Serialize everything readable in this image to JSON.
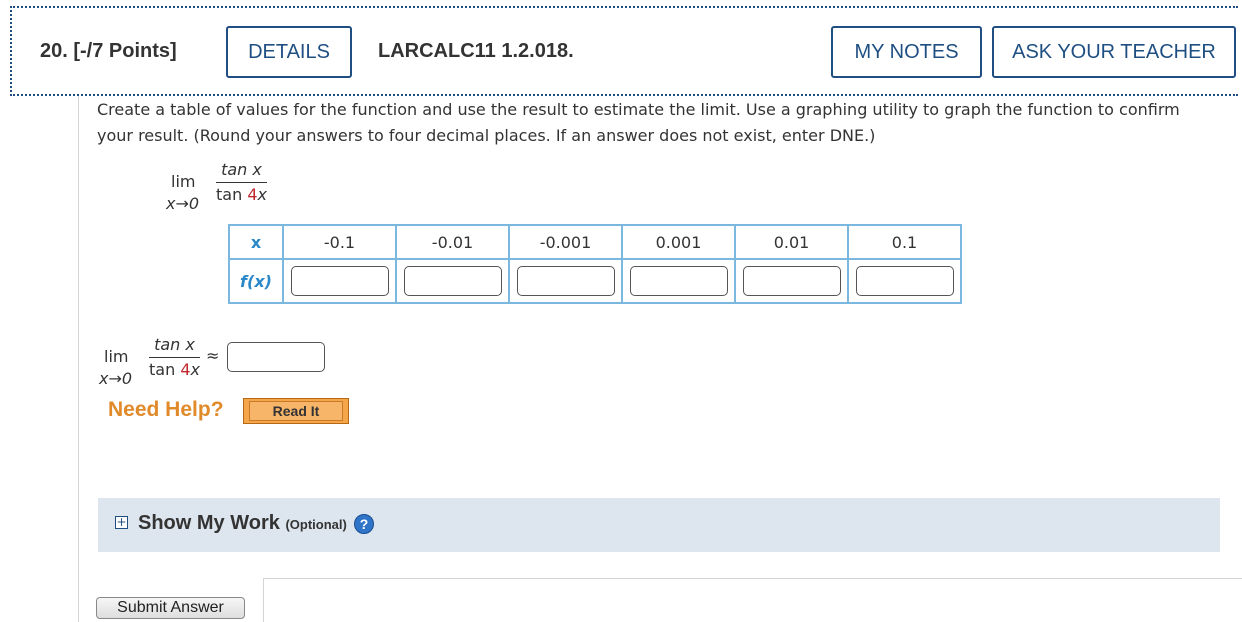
{
  "header": {
    "question_number": "20.  [-/7 Points]",
    "details_label": "DETAILS",
    "code": "LARCALC11 1.2.018.",
    "my_notes_label": "MY NOTES",
    "ask_teacher_label": "ASK YOUR TEACHER"
  },
  "instructions": "Create a table of values for the function and use the result to estimate the limit. Use a graphing utility to graph the function to confirm your result. (Round your answers to four decimal places. If an answer does not exist, enter DNE.)",
  "limit": {
    "lim": "lim",
    "approach": "x→0",
    "numerator": "tan x",
    "den_prefix": "tan ",
    "den_coef": "4",
    "den_var": "x"
  },
  "table": {
    "x_header": "x",
    "fx_header": "f(x)",
    "x_values": [
      "-0.1",
      "-0.01",
      "-0.001",
      "0.001",
      "0.01",
      "0.1"
    ]
  },
  "answer": {
    "approx_symbol": "≈"
  },
  "help": {
    "need_help": "Need Help?",
    "read_it": "Read It"
  },
  "show_work": {
    "plus_icon": "+",
    "label": "Show My Work",
    "optional": "(Optional)",
    "help_icon": "?"
  },
  "submit_label": "Submit Answer",
  "colors": {
    "accent": "#1f4f82",
    "table_border": "#7ab8e0",
    "need_help": "#e08a2a",
    "coef_red": "#c0282d"
  }
}
